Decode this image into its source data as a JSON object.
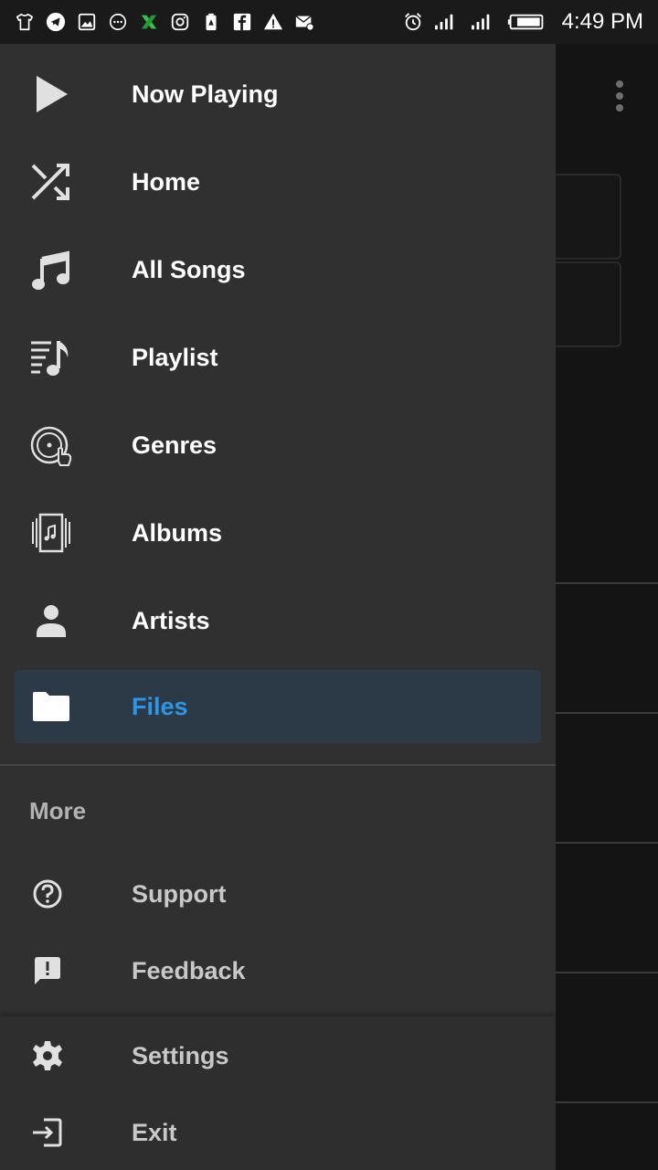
{
  "status_bar": {
    "time": "4:49 PM",
    "left_icons": [
      "shirt-icon",
      "telegram-icon",
      "image-icon",
      "message-dots-icon",
      "x-app-icon",
      "instagram-icon",
      "battery-saver-icon",
      "facebook-icon",
      "warning-icon",
      "mail-settings-icon"
    ],
    "right_icons": [
      "alarm-icon",
      "signal-icon",
      "signal-icon",
      "battery-icon"
    ]
  },
  "drawer": {
    "items": [
      {
        "label": "Now Playing",
        "icon": "play-icon"
      },
      {
        "label": "Home",
        "icon": "shuffle-icon"
      },
      {
        "label": "All Songs",
        "icon": "music-note-icon"
      },
      {
        "label": "Playlist",
        "icon": "playlist-icon"
      },
      {
        "label": "Genres",
        "icon": "genres-disc-icon"
      },
      {
        "label": "Albums",
        "icon": "albums-icon"
      },
      {
        "label": "Artists",
        "icon": "person-icon"
      },
      {
        "label": "Files",
        "icon": "folder-icon",
        "active": true
      }
    ],
    "more_section": {
      "title": "More",
      "items": [
        {
          "label": "Support",
          "icon": "help-circle-icon"
        },
        {
          "label": "Feedback",
          "icon": "feedback-icon"
        }
      ]
    },
    "footer": {
      "items": [
        {
          "label": "Settings",
          "icon": "gear-icon"
        },
        {
          "label": "Exit",
          "icon": "exit-icon"
        }
      ]
    }
  },
  "colors": {
    "drawer_bg": "#303030",
    "active_bg": "#2c3a48",
    "active_text": "#2d96e6",
    "text_primary": "#ffffff",
    "text_secondary": "#c8c8c8"
  }
}
